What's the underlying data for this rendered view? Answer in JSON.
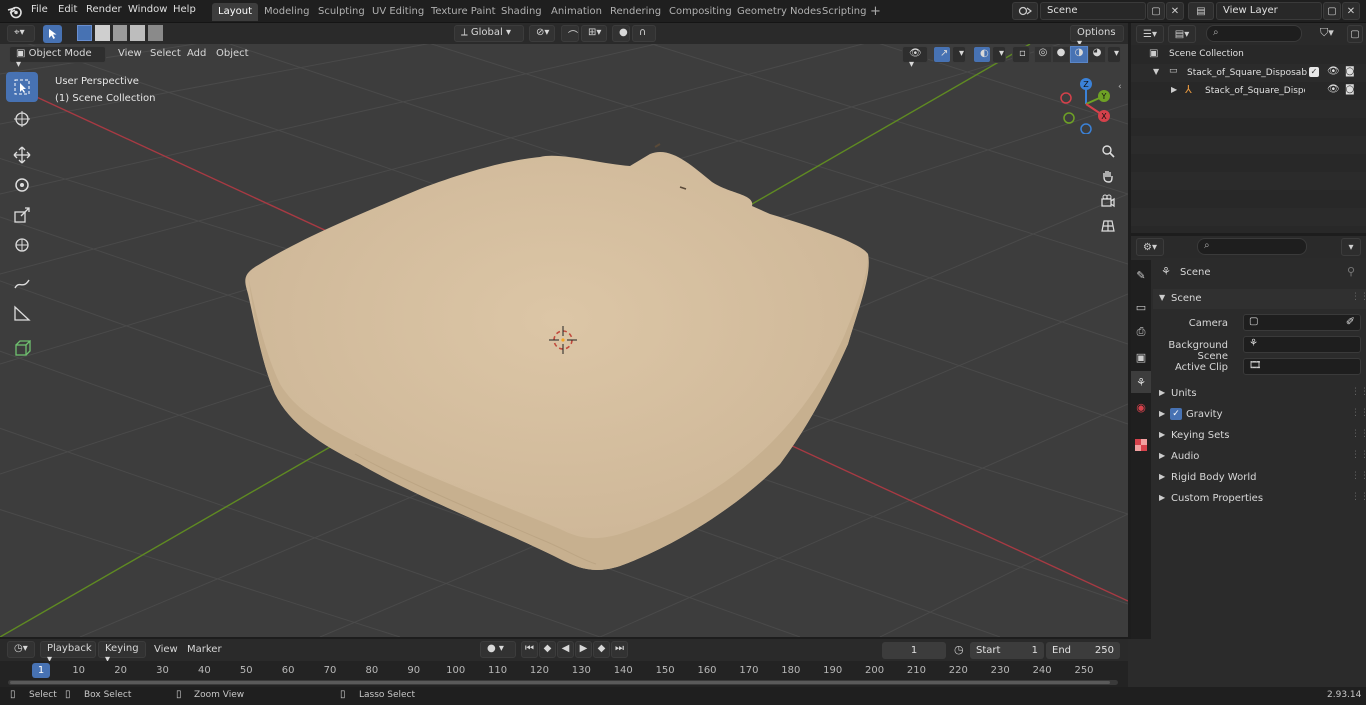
{
  "topbar": {
    "menus": [
      "File",
      "Edit",
      "Render",
      "Window",
      "Help"
    ],
    "workspaces": [
      "Layout",
      "Modeling",
      "Sculpting",
      "UV Editing",
      "Texture Paint",
      "Shading",
      "Animation",
      "Rendering",
      "Compositing",
      "Geometry Nodes",
      "Scripting"
    ],
    "active_workspace": "Layout",
    "scene_name": "Scene",
    "view_layer": "View Layer"
  },
  "viewport_header": {
    "mode": "Object Mode",
    "menus": [
      "View",
      "Select",
      "Add",
      "Object"
    ],
    "orientation": "Global",
    "options": "Options"
  },
  "viewport": {
    "view_name": "User Perspective",
    "collection": "(1) Scene Collection",
    "gizmo": {
      "x": "X",
      "y": "Y",
      "z": "Z"
    }
  },
  "outliner": {
    "root": "Scene Collection",
    "items": [
      {
        "label": "Stack_of_Square_Disposable_"
      },
      {
        "label": "Stack_of_Square_Disposa"
      }
    ]
  },
  "properties": {
    "context": "Scene",
    "panel": "Scene",
    "fields": [
      {
        "label": "Camera"
      },
      {
        "label": "Background Scene"
      },
      {
        "label": "Active Clip"
      }
    ],
    "sections": [
      "Units",
      "Gravity",
      "Keying Sets",
      "Audio",
      "Rigid Body World",
      "Custom Properties"
    ]
  },
  "timeline": {
    "menus": [
      "Playback",
      "Keying",
      "View",
      "Marker"
    ],
    "current_frame": "1",
    "start_label": "Start",
    "start": "1",
    "end_label": "End",
    "end": "250",
    "ticks": [
      "1",
      "10",
      "20",
      "30",
      "40",
      "50",
      "60",
      "70",
      "80",
      "90",
      "100",
      "110",
      "120",
      "130",
      "140",
      "150",
      "160",
      "170",
      "180",
      "190",
      "200",
      "210",
      "220",
      "230",
      "240",
      "250"
    ]
  },
  "statusbar": {
    "select": "Select",
    "box_select": "Box Select",
    "zoom_view": "Zoom View",
    "lasso_select": "Lasso Select",
    "version": "2.93.14"
  },
  "colors": {
    "accent": "#4772b3",
    "x_axis": "#d5414b",
    "y_axis": "#6ea125",
    "z_axis": "#3b82d8",
    "object": "#d9c3a3"
  }
}
